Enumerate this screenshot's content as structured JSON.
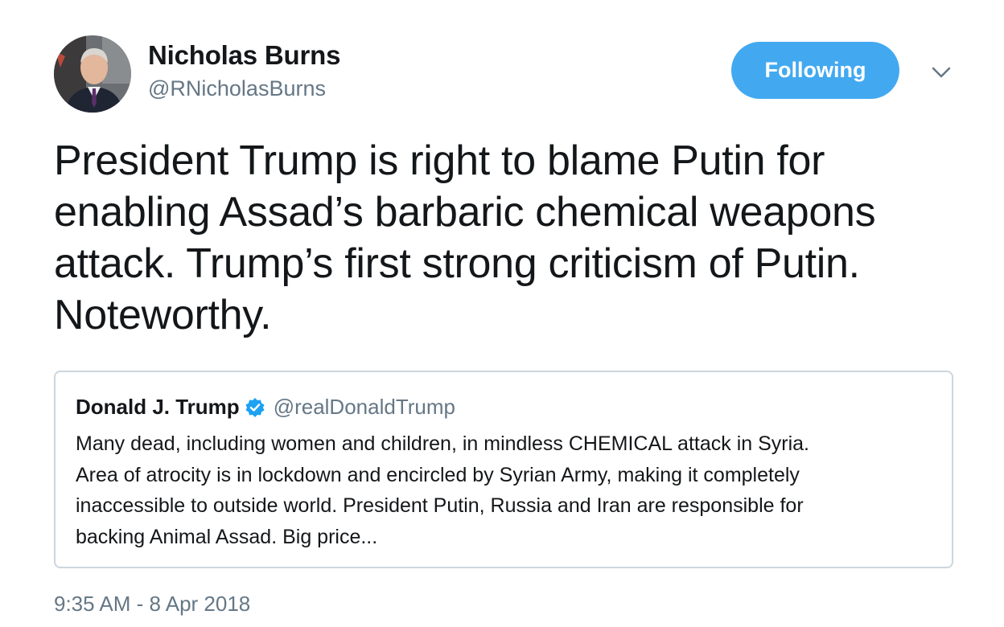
{
  "author": {
    "display_name": "Nicholas Burns",
    "handle": "@RNicholasBurns",
    "avatar": "avatar-photo"
  },
  "follow_button": {
    "label": "Following",
    "color": "#42a9f0"
  },
  "menu_icon": "chevron-down-icon",
  "tweet": {
    "text": "President Trump is right to blame Putin for\nenabling Assad’s barbaric chemical weapons\nattack.  Trump’s first strong criticism of Putin.\nNoteworthy."
  },
  "quoted_tweet": {
    "display_name": "Donald J. Trump",
    "verified_icon": "verified-badge-icon",
    "handle": "@realDonaldTrump",
    "text": "Many dead, including women and children, in mindless CHEMICAL attack in Syria.\nArea of atrocity is in lockdown and encircled by Syrian Army, making it completely\ninaccessible to outside world. President Putin, Russia and Iran are responsible for\nbacking Animal Assad. Big price..."
  },
  "timestamp": "9:35 AM - 8 Apr 2018",
  "colors": {
    "text": "#14171a",
    "secondary": "#657786",
    "border": "#ccd6dd",
    "accent": "#1da1f2"
  }
}
